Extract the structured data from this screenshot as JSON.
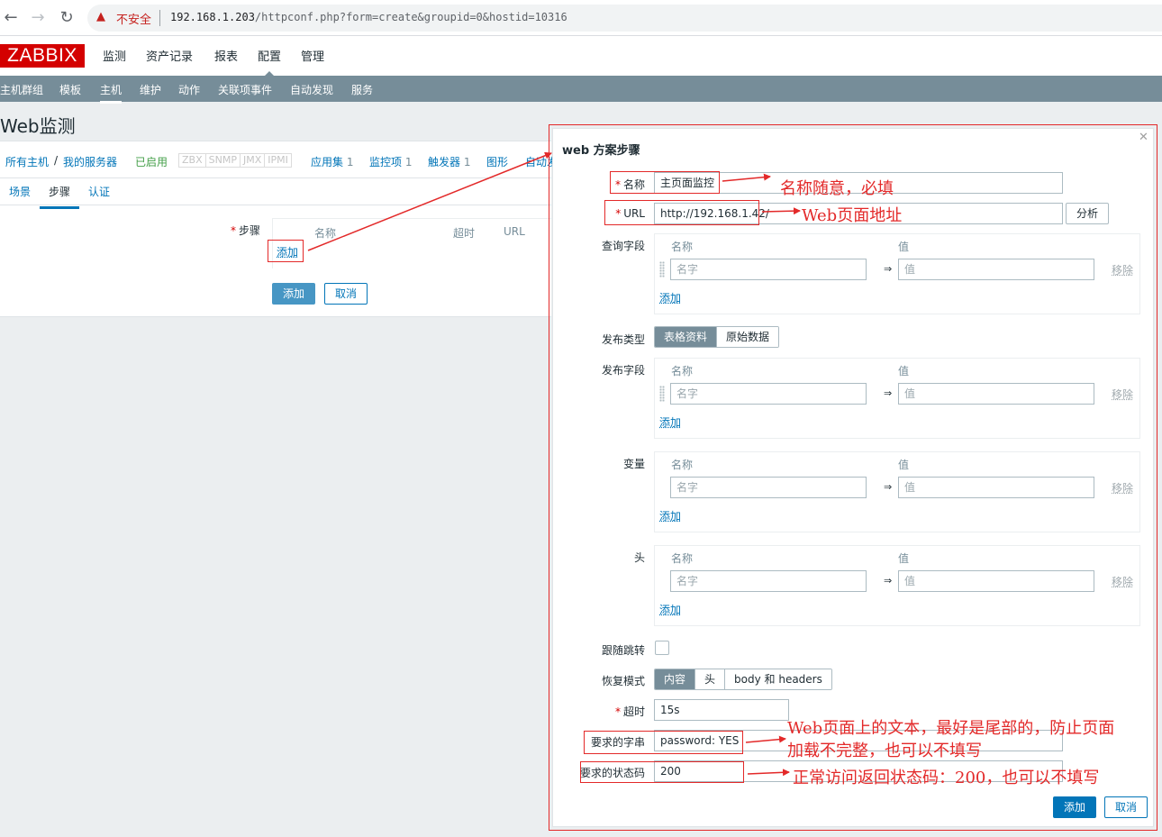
{
  "browser": {
    "back_icon": "arrow-left-icon",
    "forward_icon": "arrow-right-icon",
    "reload_icon": "reload-icon",
    "security_label": "不安全",
    "url_host": "192.168.1.203",
    "url_path": "/httpconf.php?form=create&groupid=0&hostid=10316"
  },
  "top_menu": {
    "logo": "ZABBIX",
    "items": [
      "监测",
      "资产记录",
      "报表",
      "配置",
      "管理"
    ]
  },
  "sub_menu": {
    "items": [
      "主机群组",
      "模板",
      "主机",
      "维护",
      "动作",
      "关联项事件",
      "自动发现",
      "服务"
    ]
  },
  "page_title": "Web监测",
  "host_nav": {
    "all_hosts": "所有主机",
    "separator": "/",
    "host_name": "我的服务器",
    "status": "已启用",
    "availability": [
      "ZBX",
      "SNMP",
      "JMX",
      "IPMI"
    ],
    "applications": "应用集",
    "applications_count": "1",
    "items": "监控项",
    "items_count": "1",
    "triggers": "触发器",
    "triggers_count": "1",
    "graphs": "图形",
    "discovery": "自动发"
  },
  "form_tabs": [
    "场景",
    "步骤",
    "认证"
  ],
  "steps_section": {
    "label": "步骤",
    "columns": [
      "名称",
      "超时",
      "URL"
    ],
    "add_link": "添加"
  },
  "form_buttons": {
    "add": "添加",
    "cancel": "取消"
  },
  "dialog": {
    "title": "web 方案步骤",
    "close_icon": "close-icon",
    "name_label": "名称",
    "name_value": "主页面监控",
    "url_label": "URL",
    "url_value": "http://192.168.1.42/",
    "analyze_button": "分析",
    "query_fields_label": "查询字段",
    "post_type_label": "发布类型",
    "post_type_options": [
      "表格资料",
      "原始数据"
    ],
    "post_fields_label": "发布字段",
    "variables_label": "变量",
    "headers_label": "头",
    "pair_name_header": "名称",
    "pair_value_header": "值",
    "pair_name_placeholder": "名字",
    "pair_value_placeholder": "值",
    "pair_arrow": "⇒",
    "pair_remove": "移除",
    "pair_add": "添加",
    "follow_redirects_label": "跟随跳转",
    "retrieve_mode_label": "恢复模式",
    "retrieve_mode_options": [
      "内容",
      "头",
      "body 和 headers"
    ],
    "timeout_label": "超时",
    "timeout_value": "15s",
    "required_string_label": "要求的字串",
    "required_string_value": "password: YES",
    "status_codes_label": "要求的状态码",
    "status_codes_value": "200",
    "add_button": "添加",
    "cancel_button": "取消"
  },
  "annotations": {
    "name_note": "名称随意，必填",
    "url_note": "Web页面地址",
    "string_note_line1": "Web页面上的文本，最好是尾部的，防止页面",
    "string_note_line2": "加载不完整，也可以不填写",
    "status_note": "正常访问返回状态码：200，也可以不填写",
    "color": "#e32929"
  }
}
